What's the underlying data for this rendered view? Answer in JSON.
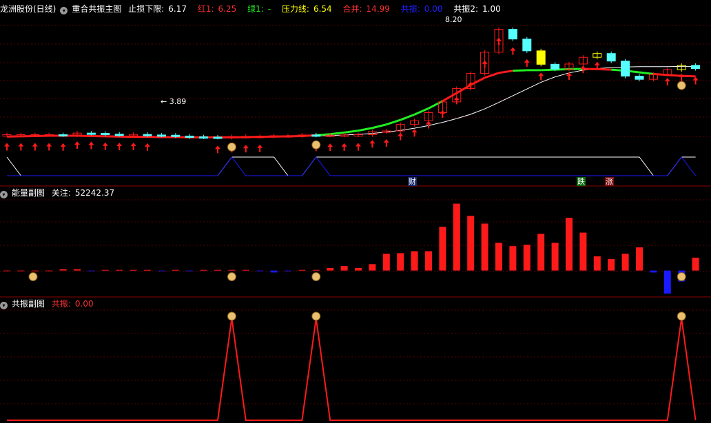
{
  "panel1": {
    "stock": "龙洲股份(日线)",
    "indicator": "重合共振主图",
    "stop_label": "止损下限:",
    "stop_value": "6.17",
    "red_label": "红1:",
    "red_value": "6.25",
    "green_label": "绿1:",
    "green_value": "-",
    "pressure_label": "压力线:",
    "pressure_value": "6.54",
    "merge_label": "合并:",
    "merge_value": "14.99",
    "res_label": "共振:",
    "res_value": "0.00",
    "res2_label": "共振2:",
    "res2_value": "1.00",
    "high_annotation": "8.20",
    "low_annotation": "← 3.89",
    "tag_cai": "财",
    "tag_die": "跌",
    "tag_zhang": "涨"
  },
  "panel2": {
    "name": "能量副图",
    "focus_label": "关注:",
    "focus_value": "52242.37"
  },
  "panel3": {
    "name": "共振副图",
    "res_label": "共振:",
    "res_value": "0.00"
  },
  "colors": {
    "up": "#ff1a1a",
    "down": "#1a1aff",
    "green": "#22ee22",
    "cyan": "#55ffff",
    "yellow": "#ffff00",
    "white": "#ffffff",
    "grid": "#5a0000",
    "border": "#8b0000"
  },
  "chart_data": [
    {
      "type": "line",
      "title": "重合共振主图",
      "x": [
        1,
        2,
        3,
        4,
        5,
        6,
        7,
        8,
        9,
        10,
        11,
        12,
        13,
        14,
        15,
        16,
        17,
        18,
        19,
        20,
        21,
        22,
        23,
        24,
        25,
        26,
        27,
        28,
        29,
        30,
        31,
        32,
        33,
        34,
        35,
        36,
        37,
        38,
        39,
        40,
        41,
        42,
        43,
        44,
        45,
        46,
        47,
        48,
        49,
        50
      ],
      "series": [
        {
          "name": "close",
          "values": [
            4.0,
            4.0,
            4.0,
            4.0,
            3.99,
            4.06,
            4.05,
            4.02,
            4.01,
            4.01,
            3.99,
            3.98,
            3.95,
            3.92,
            3.91,
            3.9,
            3.93,
            3.93,
            3.94,
            3.96,
            3.96,
            3.99,
            3.98,
            3.98,
            3.99,
            4.0,
            4.11,
            4.14,
            4.38,
            4.52,
            4.82,
            5.22,
            5.72,
            6.28,
            7.07,
            7.92,
            7.56,
            7.12,
            6.62,
            6.44,
            6.63,
            6.88,
            7.02,
            6.74,
            6.18,
            6.06,
            6.24,
            6.42,
            6.58,
            6.46
          ]
        },
        {
          "name": "stop",
          "values": [
            3.93,
            3.94,
            3.95,
            3.96,
            3.96,
            3.96,
            3.95,
            3.94,
            3.93,
            3.92,
            3.92,
            3.91,
            3.91,
            3.9,
            3.9,
            3.9,
            3.9,
            3.91,
            3.92,
            3.93,
            3.94,
            3.95,
            3.98,
            4.02,
            4.08,
            4.15,
            4.25,
            4.38,
            4.55,
            4.75,
            4.98,
            5.25,
            5.55,
            5.85,
            6.12,
            6.3,
            6.38,
            6.4,
            6.4,
            6.42,
            6.44,
            6.45,
            6.44,
            6.42,
            6.38,
            6.32,
            6.26,
            6.22,
            6.19,
            6.17
          ]
        },
        {
          "name": "pressure",
          "values": [
            3.92,
            3.93,
            3.94,
            3.94,
            3.95,
            3.95,
            3.95,
            3.94,
            3.93,
            3.93,
            3.92,
            3.92,
            3.91,
            3.91,
            3.9,
            3.9,
            3.91,
            3.91,
            3.92,
            3.93,
            3.94,
            3.95,
            3.96,
            3.97,
            3.99,
            4.01,
            4.05,
            4.1,
            4.16,
            4.24,
            4.34,
            4.46,
            4.6,
            4.76,
            4.96,
            5.2,
            5.45,
            5.7,
            5.95,
            6.15,
            6.3,
            6.4,
            6.46,
            6.5,
            6.52,
            6.53,
            6.53,
            6.53,
            6.54,
            6.54
          ]
        }
      ],
      "annotations": [
        "8.20",
        "← 3.89"
      ],
      "ylim": [
        3.5,
        8.5
      ]
    },
    {
      "type": "line",
      "title": "",
      "x": [
        1,
        2,
        3,
        4,
        5,
        6,
        7,
        8,
        9,
        10,
        11,
        12,
        13,
        14,
        15,
        16,
        17,
        18,
        19,
        20,
        21,
        22,
        23,
        24,
        25,
        26,
        27,
        28,
        29,
        30,
        31,
        32,
        33,
        34,
        35,
        36,
        37,
        38,
        39,
        40,
        41,
        42,
        43,
        44,
        45,
        46,
        47,
        48,
        49,
        50
      ],
      "series": [
        {
          "name": "white",
          "values": [
            1,
            0,
            0,
            0,
            0,
            0,
            0,
            0,
            0,
            0,
            0,
            0,
            0,
            0,
            0,
            0,
            1,
            1,
            1,
            1,
            0,
            0,
            1,
            1,
            1,
            1,
            1,
            1,
            1,
            1,
            1,
            1,
            1,
            1,
            1,
            1,
            1,
            1,
            1,
            1,
            1,
            1,
            1,
            1,
            1,
            1,
            0,
            0,
            1,
            1
          ]
        },
        {
          "name": "blue",
          "values": [
            0,
            0,
            0,
            0,
            0,
            0,
            0,
            0,
            0,
            0,
            0,
            0,
            0,
            0,
            0,
            0,
            1,
            0,
            0,
            0,
            0,
            0,
            1,
            0,
            0,
            0,
            0,
            0,
            0,
            0,
            0,
            0,
            0,
            0,
            0,
            0,
            0,
            0,
            0,
            0,
            0,
            0,
            0,
            0,
            0,
            0,
            0,
            0,
            1,
            0
          ]
        }
      ],
      "annotations": [
        "财",
        "跌",
        "涨"
      ],
      "ylim": [
        0,
        1
      ]
    },
    {
      "type": "bar",
      "title": "能量副图",
      "categories": [
        1,
        2,
        3,
        4,
        5,
        6,
        7,
        8,
        9,
        10,
        11,
        12,
        13,
        14,
        15,
        16,
        17,
        18,
        19,
        20,
        21,
        22,
        23,
        24,
        25,
        26,
        27,
        28,
        29,
        30,
        31,
        32,
        33,
        34,
        35,
        36,
        37,
        38,
        39,
        40,
        41,
        42,
        43,
        44,
        45,
        46,
        47,
        48,
        49,
        50
      ],
      "values": [
        0,
        0,
        0,
        0,
        2000,
        2000,
        -1000,
        1000,
        1000,
        1000,
        1000,
        -1000,
        1000,
        -1000,
        1000,
        1000,
        1000,
        1000,
        -1000,
        -3000,
        -1000,
        1000,
        1000,
        4000,
        7000,
        4000,
        10000,
        26000,
        27000,
        30000,
        30000,
        68000,
        104000,
        85000,
        73000,
        43000,
        38000,
        40000,
        57000,
        43000,
        82000,
        59000,
        22000,
        18000,
        26000,
        36000,
        -3000,
        -36000,
        -17000,
        20000
      ],
      "ylim": [
        -40000,
        110000
      ]
    },
    {
      "type": "line",
      "title": "共振副图",
      "x": [
        1,
        2,
        3,
        4,
        5,
        6,
        7,
        8,
        9,
        10,
        11,
        12,
        13,
        14,
        15,
        16,
        17,
        18,
        19,
        20,
        21,
        22,
        23,
        24,
        25,
        26,
        27,
        28,
        29,
        30,
        31,
        32,
        33,
        34,
        35,
        36,
        37,
        38,
        39,
        40,
        41,
        42,
        43,
        44,
        45,
        46,
        47,
        48,
        49,
        50
      ],
      "series": [
        {
          "name": "共振",
          "values": [
            0,
            0,
            0,
            0,
            0,
            0,
            0,
            0,
            0,
            0,
            0,
            0,
            0,
            0,
            0,
            0,
            1,
            0,
            0,
            0,
            0,
            0,
            1,
            0,
            0,
            0,
            0,
            0,
            0,
            0,
            0,
            0,
            0,
            0,
            0,
            0,
            0,
            0,
            0,
            0,
            0,
            0,
            0,
            0,
            0,
            0,
            0,
            0,
            1,
            0
          ]
        }
      ],
      "ylim": [
        0,
        1
      ]
    }
  ]
}
